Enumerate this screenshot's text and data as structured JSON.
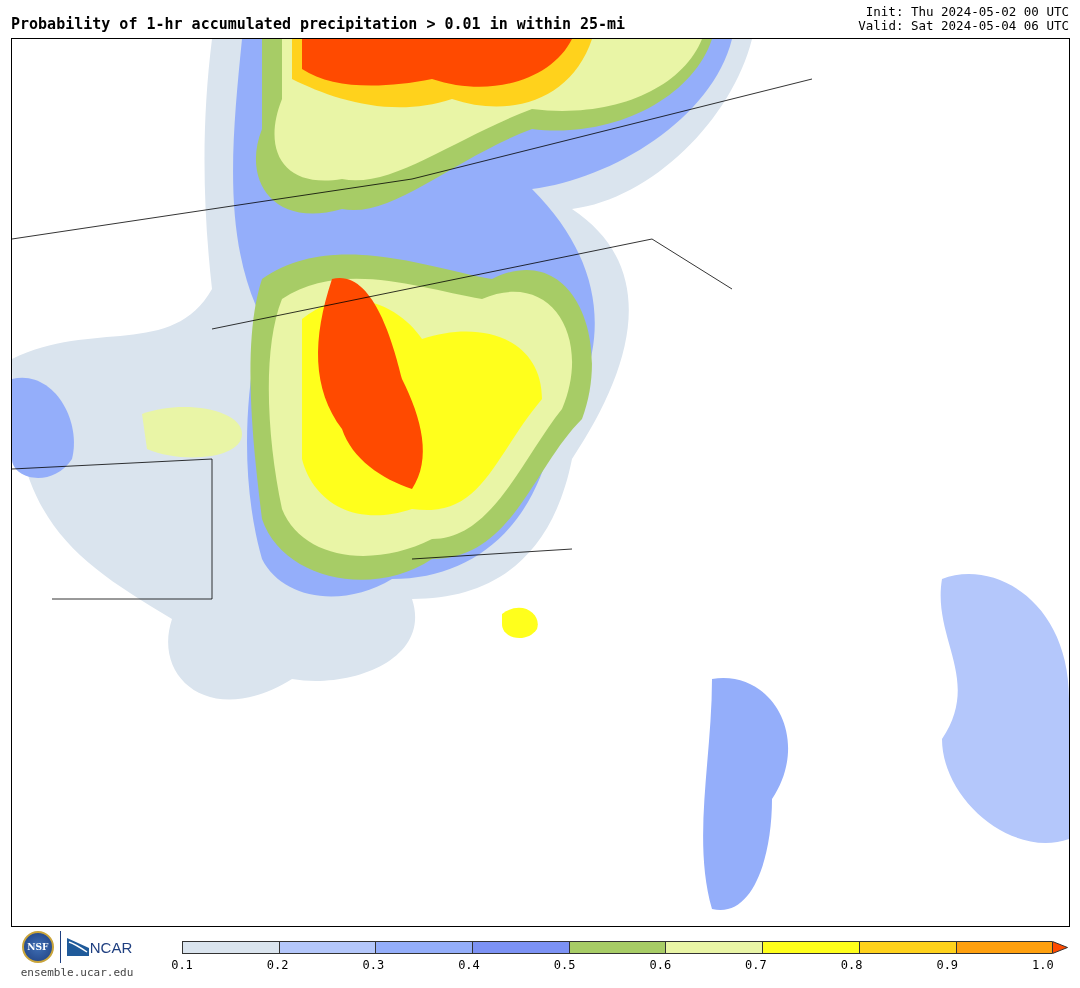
{
  "title": "Probability of 1-hr accumulated precipitation > 0.01 in within 25-mi",
  "init": "Init: Thu 2024-05-02 00 UTC",
  "valid": "Valid: Sat 2024-05-04 06 UTC",
  "logos": {
    "nsf": "NSF",
    "ncar": "NCAR",
    "site": "ensemble.ucar.edu"
  },
  "colorbar": {
    "segments": [
      {
        "color": "#dae4ee"
      },
      {
        "color": "#b4c7fb"
      },
      {
        "color": "#94aefa"
      },
      {
        "color": "#7c92f4"
      },
      {
        "color": "#a7cc66"
      },
      {
        "color": "#e9f5a6"
      },
      {
        "color": "#ffff1c"
      },
      {
        "color": "#ffd21c"
      },
      {
        "color": "#ffa00e"
      }
    ],
    "extension": {
      "color": "#ff4a00"
    },
    "ticks": [
      "0.1",
      "0.2",
      "0.3",
      "0.4",
      "0.5",
      "0.6",
      "0.7",
      "0.8",
      "0.9",
      "1.0"
    ]
  }
}
